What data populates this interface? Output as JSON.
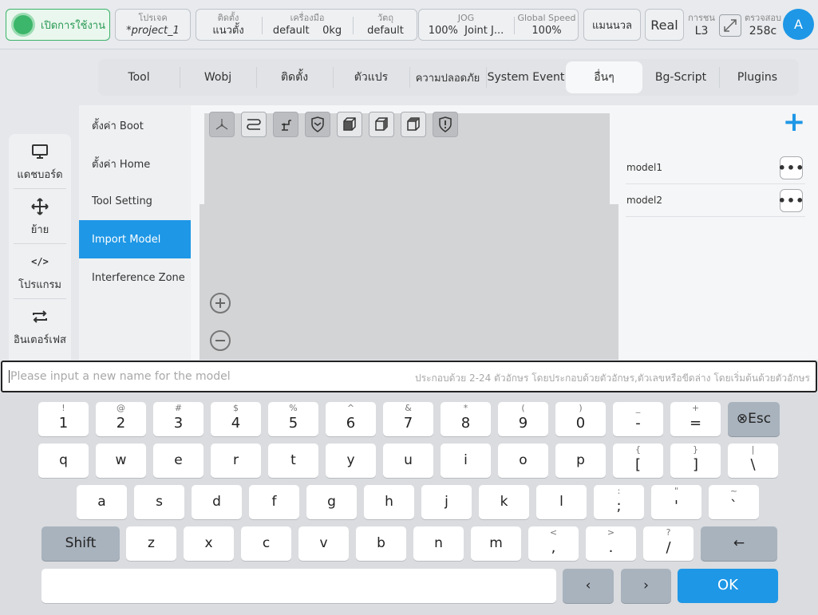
{
  "topbar": {
    "enable_label": "เปิดการใช้งาน",
    "project_caption": "โปรเจค",
    "project_value": "*project_1",
    "mount_caption": "ติดตั้ง",
    "mount_value": "แนวตั้ง",
    "tool_caption": "เครื่องมือ",
    "tool_value": "default",
    "payload_value": "0kg",
    "object_caption": "วัตถุ",
    "object_value": "default",
    "jog_caption": "JOG",
    "jog_value": "100%",
    "jog_mode": "Joint J...",
    "speed_caption": "Global Speed",
    "speed_value": "100%",
    "manual_label": "แมนนวล",
    "real_label": "Real",
    "collision_caption": "การชน",
    "collision_value": "L3",
    "check_caption": "ตรวจสอบ",
    "check_value": "258c",
    "avatar_letter": "A"
  },
  "tabs": [
    "Tool",
    "Wobj",
    "ติดตั้ง",
    "ตัวแปร",
    "ความปลอดภัย",
    "System Event",
    "อื่นๆ",
    "Bg-Script",
    "Plugins"
  ],
  "active_tab": "อื่นๆ",
  "leftnav": [
    {
      "label": "แดชบอร์ด",
      "icon": "monitor-icon"
    },
    {
      "label": "ย้าย",
      "icon": "move-icon"
    },
    {
      "label": "โปรแกรม",
      "icon": "code-icon"
    },
    {
      "label": "อินเตอร์เฟส",
      "icon": "interface-icon"
    }
  ],
  "menu": [
    "ตั้งค่า Boot",
    "ตั้งค่า Home",
    "Tool Setting",
    "Import Model",
    "Interference Zone"
  ],
  "active_menu": "Import Model",
  "models": [
    "model1",
    "model2"
  ],
  "add_label": "+",
  "more_label": "•••",
  "zoom_in": "⊕",
  "zoom_out": "⊖",
  "input": {
    "placeholder": "Please input a new name for the model",
    "hint": "ประกอบด้วย 2-24 ตัวอักษร โดยประกอบด้วยตัวอักษร,ตัวเลขหรือขีดล่าง โดยเริ่มต้นด้วยตัวอักษร"
  },
  "keyboard": {
    "row1": [
      [
        "!",
        "1"
      ],
      [
        "@",
        "2"
      ],
      [
        "#",
        "3"
      ],
      [
        "$",
        "4"
      ],
      [
        "%",
        "5"
      ],
      [
        "^",
        "6"
      ],
      [
        "&",
        "7"
      ],
      [
        "*",
        "8"
      ],
      [
        "(",
        "9"
      ],
      [
        ")",
        "0"
      ],
      [
        "_",
        "-"
      ],
      [
        "+",
        "="
      ]
    ],
    "esc": "⊗Esc",
    "row2": [
      [
        "",
        "q"
      ],
      [
        "",
        "w"
      ],
      [
        "",
        "e"
      ],
      [
        "",
        "r"
      ],
      [
        "",
        "t"
      ],
      [
        "",
        "y"
      ],
      [
        "",
        "u"
      ],
      [
        "",
        "i"
      ],
      [
        "",
        "o"
      ],
      [
        "",
        "p"
      ],
      [
        "{",
        "["
      ],
      [
        "}",
        "]"
      ],
      [
        "|",
        "\\"
      ]
    ],
    "row3": [
      [
        "",
        "a"
      ],
      [
        "",
        "s"
      ],
      [
        "",
        "d"
      ],
      [
        "",
        "f"
      ],
      [
        "",
        "g"
      ],
      [
        "",
        "h"
      ],
      [
        "",
        "j"
      ],
      [
        "",
        "k"
      ],
      [
        "",
        "l"
      ],
      [
        ":",
        ";"
      ],
      [
        "\"",
        "'"
      ],
      [
        "~",
        "`"
      ]
    ],
    "shift": "Shift",
    "row4": [
      [
        "",
        "z"
      ],
      [
        "",
        "x"
      ],
      [
        "",
        "c"
      ],
      [
        "",
        "v"
      ],
      [
        "",
        "b"
      ],
      [
        "",
        "n"
      ],
      [
        "",
        "m"
      ],
      [
        "<",
        ","
      ],
      [
        ">",
        "."
      ],
      [
        "?",
        "/"
      ]
    ],
    "backspace": "←",
    "left": "‹",
    "right": "›",
    "ok": "OK"
  }
}
